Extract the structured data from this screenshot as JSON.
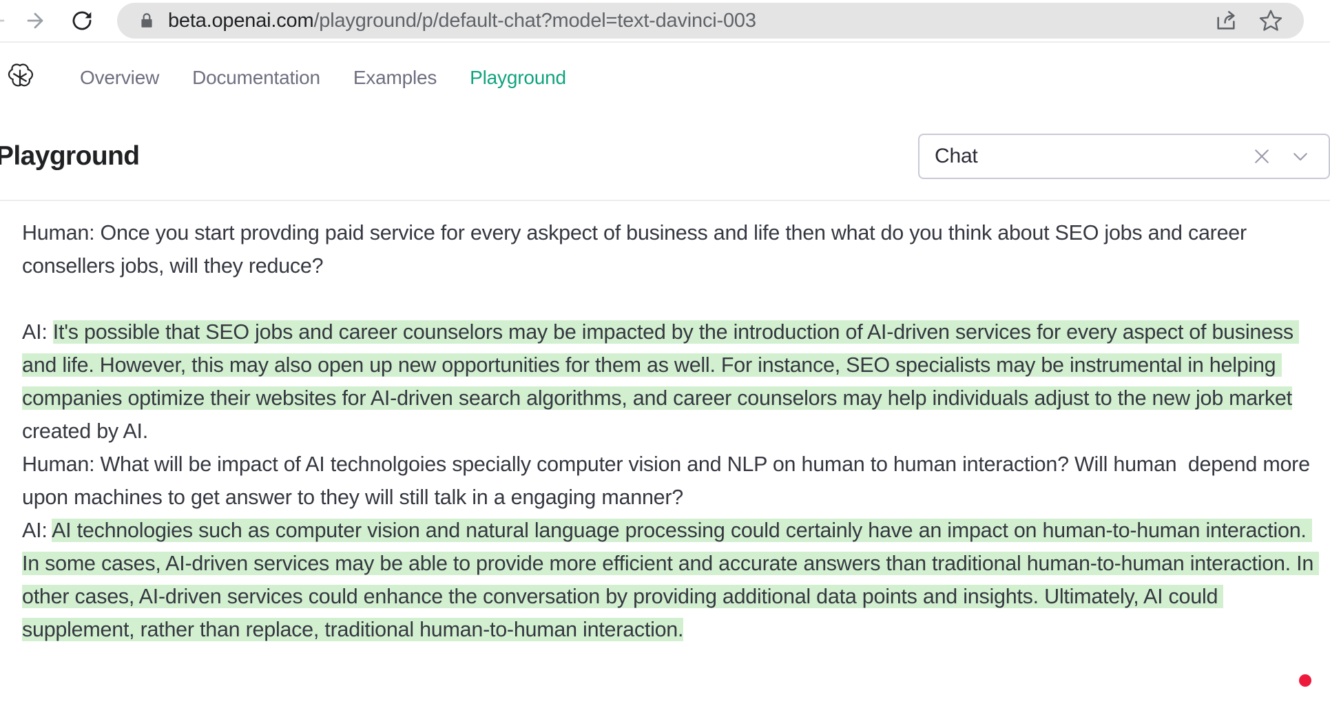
{
  "browser": {
    "back_icon": "arrow-left-icon",
    "forward_icon": "arrow-right-icon",
    "reload_icon": "reload-icon",
    "lock_icon": "lock-icon",
    "share_icon": "share-icon",
    "bookmark_icon": "star-icon",
    "url_host": "beta.openai.com",
    "url_path": "/playground/p/default-chat?model=text-davinci-003",
    "url_full": "beta.openai.com/playground/p/default-chat?model=text-davinci-003"
  },
  "site_header": {
    "logo_icon": "openai-logo-icon",
    "nav": [
      {
        "label": "Overview",
        "active": false
      },
      {
        "label": "Documentation",
        "active": false
      },
      {
        "label": "Examples",
        "active": false
      },
      {
        "label": "Playground",
        "active": true
      }
    ],
    "active_color": "#10a37f"
  },
  "page": {
    "title": "Playground",
    "preset": {
      "value": "Chat",
      "clear_icon": "close-x-icon",
      "chevron_icon": "chevron-down-icon"
    }
  },
  "editor": {
    "blocks": [
      {
        "type": "plain",
        "text": "Human: Once you start provding paid service for every askpect of business and life then what do you think about SEO jobs and career consellers jobs, will they reduce?"
      },
      {
        "type": "plain",
        "text": "\n\n"
      },
      {
        "type": "plain",
        "text": "AI: "
      },
      {
        "type": "highlight",
        "text": "It's possible that SEO jobs and career counselors may be impacted by the introduction of AI-driven services for every aspect of business and life. However, this may also open up new opportunities for them as well. For instance, SEO specialists may be instrumental in helping companies optimize their websites for AI-driven search algorithms, and career counselors may help individuals adjust to the new job market"
      },
      {
        "type": "plain",
        "text": " created by AI.\n"
      },
      {
        "type": "plain",
        "text": "Human: What will be impact of AI technolgoies specially computer vision and NLP on human to human interaction? Will human  depend more upon machines to get answer to they will still talk in a engaging manner?\n"
      },
      {
        "type": "plain",
        "text": "AI: "
      },
      {
        "type": "highlight",
        "text": "AI technologies such as computer vision and natural language processing could certainly have an impact on human-to-human interaction. In some cases, AI-driven services may be able to provide more efficient and accurate answers than traditional human-to-human interaction. In other cases, AI-driven services could enhance the conversation by providing additional data points and insights. Ultimately, AI could supplement, rather than replace, traditional human-to-human interaction."
      }
    ],
    "highlight_color": "#d2f0d0",
    "text_color": "#353740"
  },
  "overlay": {
    "record_indicator": "record-dot-icon",
    "record_color": "#ed1a3b"
  }
}
